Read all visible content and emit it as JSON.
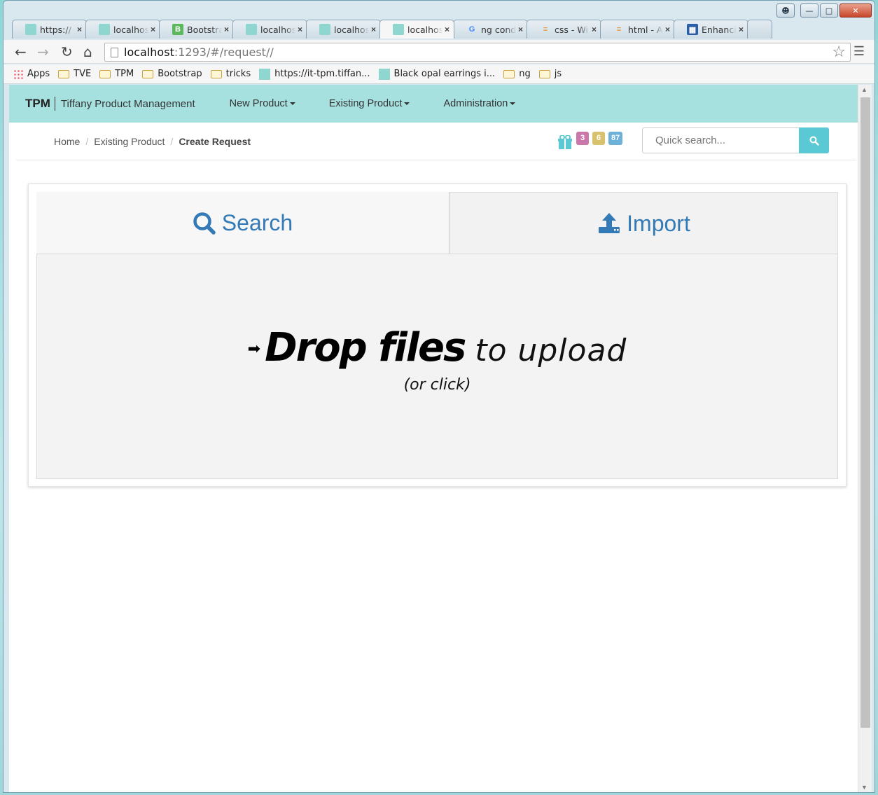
{
  "browser": {
    "tabs": [
      {
        "title": "https://",
        "favicon": "teal-square-icon",
        "active": false
      },
      {
        "title": "localhost",
        "favicon": "teal-square-icon",
        "active": false
      },
      {
        "title": "Bootstrap",
        "favicon": "bootstrap-icon",
        "active": false
      },
      {
        "title": "localhost",
        "favicon": "teal-square-icon",
        "active": false
      },
      {
        "title": "localhost",
        "favicon": "teal-square-icon",
        "active": false
      },
      {
        "title": "localhost",
        "favicon": "teal-square-icon",
        "active": true
      },
      {
        "title": "ng cond",
        "favicon": "google-icon",
        "active": false
      },
      {
        "title": "css - Wi",
        "favicon": "stackoverflow-icon",
        "active": false
      },
      {
        "title": "html - A",
        "favicon": "stackoverflow-icon",
        "active": false
      },
      {
        "title": "Enhanci",
        "favicon": "grid-icon",
        "active": false
      }
    ],
    "address": {
      "host": "localhost",
      "path": ":1293/#/request//"
    },
    "bookmarks": [
      {
        "label": "Apps",
        "icon": "apps-grid-icon"
      },
      {
        "label": "TVE",
        "icon": "folder-icon"
      },
      {
        "label": "TPM",
        "icon": "folder-icon"
      },
      {
        "label": "Bootstrap",
        "icon": "folder-icon"
      },
      {
        "label": "tricks",
        "icon": "folder-icon"
      },
      {
        "label": "https://it-tpm.tiffan...",
        "icon": "teal-square-icon"
      },
      {
        "label": "Black opal earrings i...",
        "icon": "teal-square-icon"
      },
      {
        "label": "ng",
        "icon": "folder-icon"
      },
      {
        "label": "js",
        "icon": "folder-icon"
      }
    ]
  },
  "app": {
    "brand": "TPM",
    "brand_sub": "Tiffany Product Management",
    "nav": [
      "New Product",
      "Existing Product",
      "Administration"
    ],
    "breadcrumb": {
      "home": "Home",
      "section": "Existing Product",
      "current": "Create Request"
    },
    "badges": [
      {
        "value": "3",
        "color": "#c978a9"
      },
      {
        "value": "6",
        "color": "#d8c26d"
      },
      {
        "value": "87",
        "color": "#6db0d8"
      }
    ],
    "search_placeholder": "Quick search...",
    "colors": {
      "navbar": "#a6e1e0",
      "accent": "#5bc9d4",
      "link": "#337ab7"
    }
  },
  "panel": {
    "tab_search": "Search",
    "tab_import": "Import",
    "drop_strong": "Drop files",
    "drop_light": "to upload",
    "drop_sub": "(or click)"
  }
}
